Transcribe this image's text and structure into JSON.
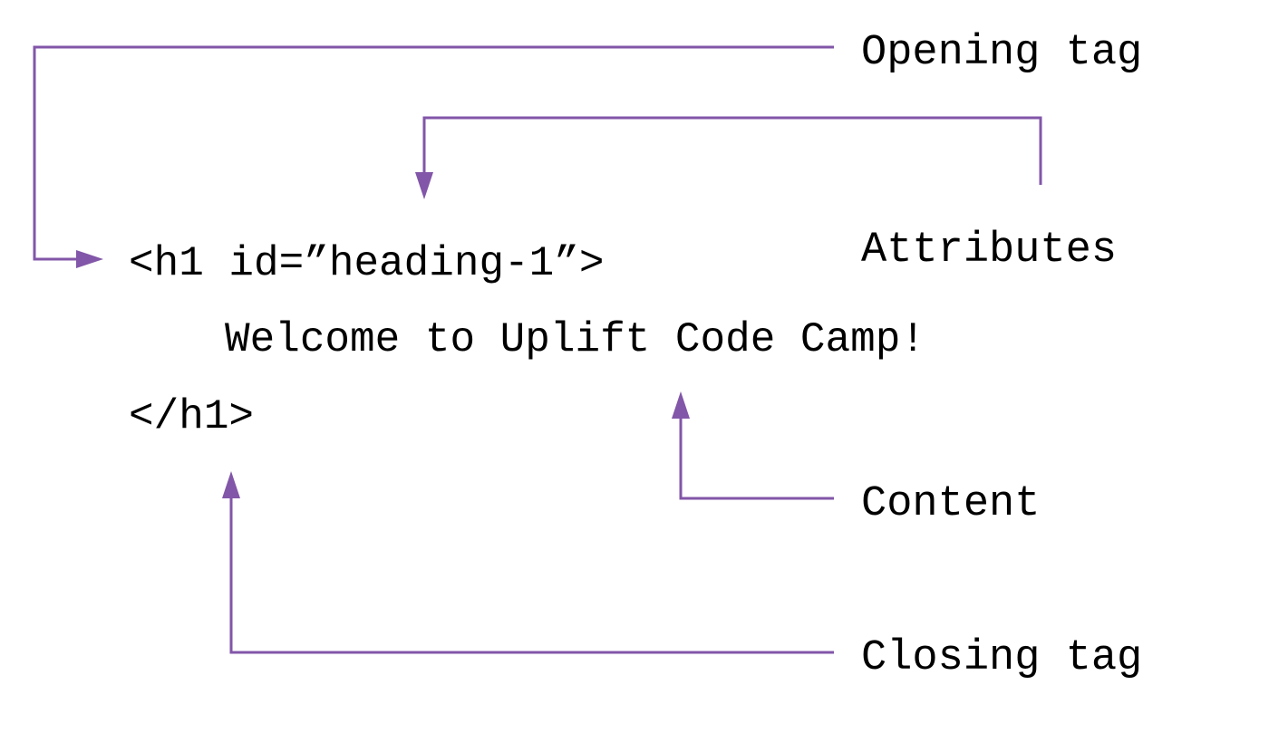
{
  "accent_color": "#8256A8",
  "text_color": "#000000",
  "code": {
    "opening_tag": "<h1 id=”heading-1”>",
    "content": "Welcome to Uplift Code Camp!",
    "closing_tag": "</h1>"
  },
  "labels": {
    "opening_tag": "Opening tag",
    "attributes": "Attributes",
    "content": "Content",
    "closing_tag": "Closing tag"
  }
}
